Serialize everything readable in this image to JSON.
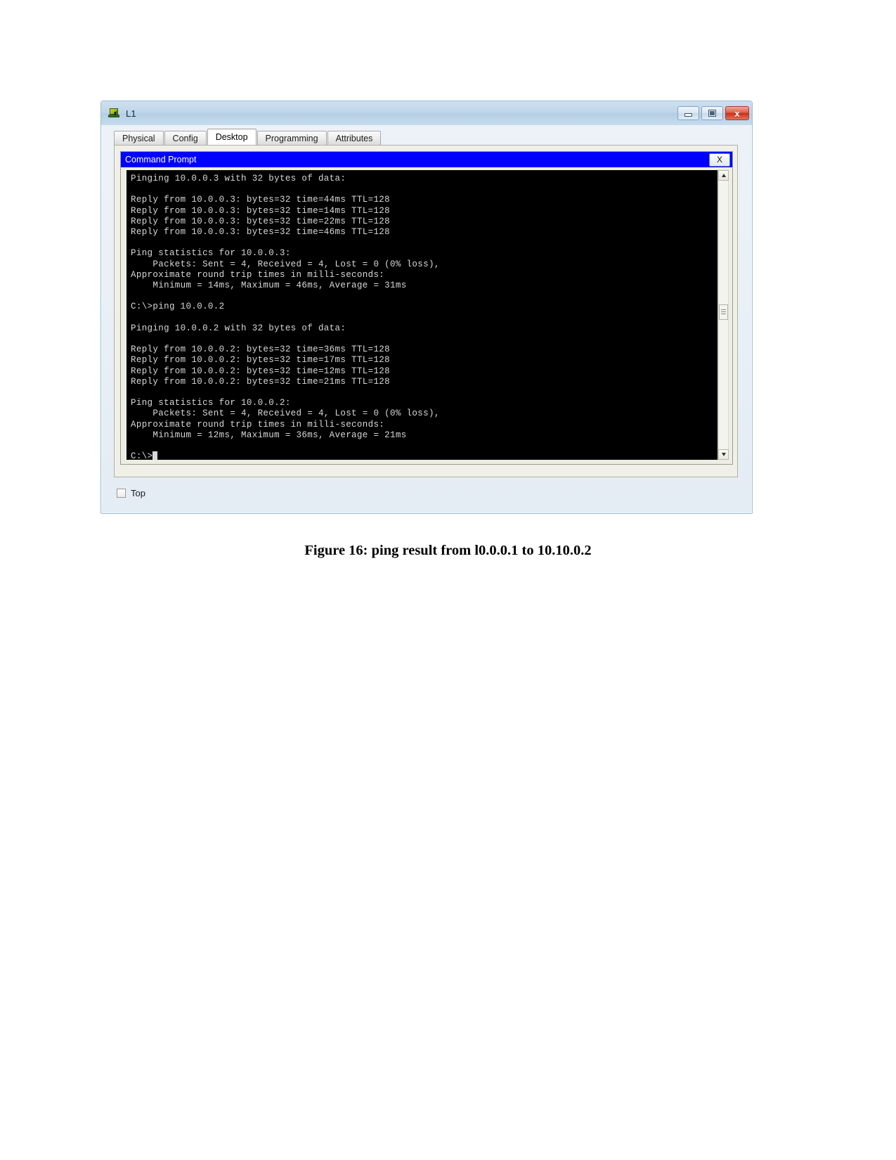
{
  "window": {
    "title": "L1",
    "icon": "laptop-device-icon",
    "controls": {
      "minimize_label": "",
      "maximize_label": "",
      "close_label": "x"
    }
  },
  "tabs": [
    {
      "label": "Physical",
      "active": false
    },
    {
      "label": "Config",
      "active": false
    },
    {
      "label": "Desktop",
      "active": true
    },
    {
      "label": "Programming",
      "active": false
    },
    {
      "label": "Attributes",
      "active": false
    }
  ],
  "command_prompt": {
    "title": "Command Prompt",
    "close_label": "X",
    "titlebar_color": "#0000ff",
    "terminal_bg": "#000000",
    "terminal_fg": "#d8d8d8",
    "output": "Pinging 10.0.0.3 with 32 bytes of data:\n\nReply from 10.0.0.3: bytes=32 time=44ms TTL=128\nReply from 10.0.0.3: bytes=32 time=14ms TTL=128\nReply from 10.0.0.3: bytes=32 time=22ms TTL=128\nReply from 10.0.0.3: bytes=32 time=46ms TTL=128\n\nPing statistics for 10.0.0.3:\n    Packets: Sent = 4, Received = 4, Lost = 0 (0% loss),\nApproximate round trip times in milli-seconds:\n    Minimum = 14ms, Maximum = 46ms, Average = 31ms\n\nC:\\>ping 10.0.0.2\n\nPinging 10.0.0.2 with 32 bytes of data:\n\nReply from 10.0.0.2: bytes=32 time=36ms TTL=128\nReply from 10.0.0.2: bytes=32 time=17ms TTL=128\nReply from 10.0.0.2: bytes=32 time=12ms TTL=128\nReply from 10.0.0.2: bytes=32 time=21ms TTL=128\n\nPing statistics for 10.0.0.2:\n    Packets: Sent = 4, Received = 4, Lost = 0 (0% loss),\nApproximate round trip times in milli-seconds:\n    Minimum = 12ms, Maximum = 36ms, Average = 21ms\n\n",
    "prompt": "C:\\>"
  },
  "bottom": {
    "top_checkbox_label": "Top",
    "top_checkbox_checked": false
  },
  "caption": {
    "text": "Figure 16: ping result from l0.0.0.1 to 10.10.0.2"
  }
}
